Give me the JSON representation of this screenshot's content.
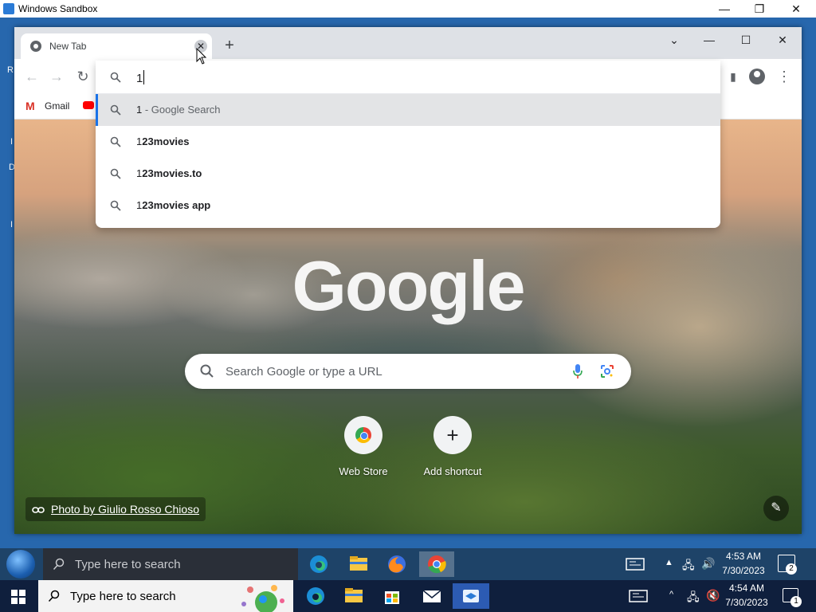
{
  "sandbox": {
    "title": "Windows Sandbox",
    "controls": [
      "—",
      "❐",
      "✕"
    ]
  },
  "desktop_fragments": [
    "R",
    "I",
    "D",
    "I"
  ],
  "browser": {
    "tab": {
      "title": "New Tab",
      "close_glyph": "✕"
    },
    "new_tab_glyph": "+",
    "window_controls": [
      "⌄",
      "—",
      "☐",
      "✕"
    ],
    "toolbar": {
      "back": "←",
      "forward": "→",
      "reload": "↻",
      "side_panel": "▮",
      "menu": "⋮"
    },
    "bookmarks": [
      {
        "label": "Gmail"
      }
    ],
    "omnibox": {
      "input_value": "1",
      "suggestions": [
        {
          "bold": "1",
          "rest": " - Google Search",
          "selected": true
        },
        {
          "bold": "1",
          "rest": "23movies",
          "selected": false
        },
        {
          "bold": "1",
          "rest": "23movies.to",
          "selected": false
        },
        {
          "bold": "1",
          "rest": "23movies app",
          "selected": false
        }
      ]
    },
    "ntp": {
      "logo": "Google",
      "search_placeholder": "Search Google or type a URL",
      "shortcuts": [
        {
          "label": "Web Store"
        },
        {
          "label": "Add shortcut"
        }
      ],
      "attribution": "Photo by Giulio Rosso Chioso",
      "edit_glyph": "✎"
    }
  },
  "inner_taskbar": {
    "search_placeholder": "Type here to search",
    "time": "4:53 AM",
    "date": "7/30/2023",
    "notifications": "2"
  },
  "host_taskbar": {
    "search_placeholder": "Type here to search",
    "time": "4:54 AM",
    "date": "7/30/2023",
    "notifications": "1"
  },
  "colors": {
    "accent": "#1a73e8",
    "chrome_frame": "#dee1e6",
    "selected_row": "#e3e4e6"
  }
}
